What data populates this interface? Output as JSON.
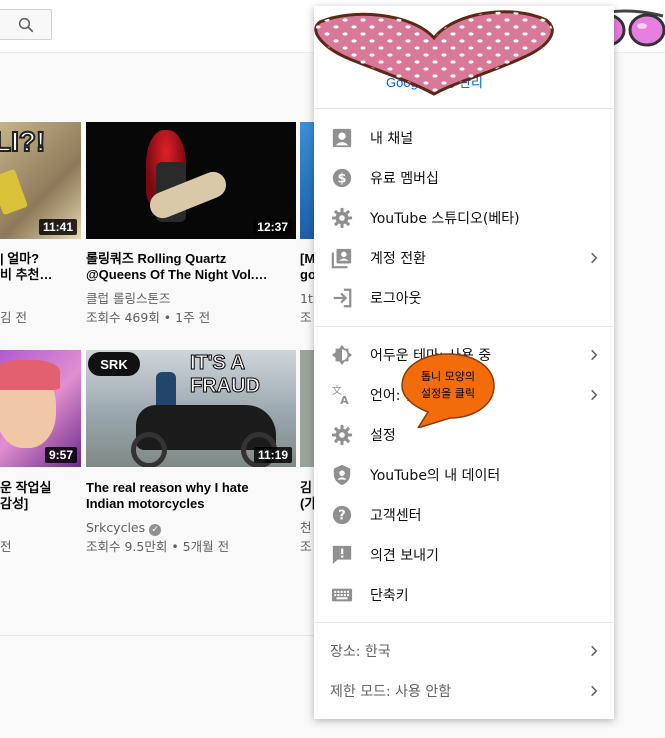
{
  "search": {
    "icon": "search-icon"
  },
  "videos": [
    {
      "id": "v1",
      "title1": "LI?!",
      "duration": "11:41",
      "line1": "| 얼마?",
      "line2": "비 추천…",
      "channel": "",
      "meta": "김 전"
    },
    {
      "id": "v2",
      "title1": "",
      "duration": "12:37",
      "line1": "롤링쿼즈 Rolling Quartz",
      "line2": "@Queens Of The Night Vol.…",
      "channel": "클럽 롤링스톤즈",
      "meta": "조회수 469회 • 1주 전"
    },
    {
      "id": "v3",
      "title1": "",
      "duration": "",
      "line1": "[M",
      "line2": "go",
      "channel": "1th",
      "meta": "조"
    },
    {
      "id": "v4",
      "title1": "",
      "duration": "9:57",
      "line1": "운 작업실",
      "line2": "감성]",
      "channel": "",
      "meta": "전"
    },
    {
      "id": "v5",
      "title1": "IT'S A FRAUD",
      "duration": "11:19",
      "line1": "The real reason why I hate",
      "line2": "Indian motorcycles",
      "channel": "Srkcycles",
      "meta": "조회수 9.5만회 • 5개월 전",
      "badge": "SRK"
    },
    {
      "id": "v6",
      "title1": "",
      "duration": "",
      "line1": "김",
      "line2": "(가",
      "channel": "천",
      "meta": "조"
    }
  ],
  "menu": {
    "manage_account": "Google 계정 관리",
    "items": [
      {
        "label": "내 채널",
        "icon": "person-icon",
        "chevron": false
      },
      {
        "label": "유료 멤버십",
        "icon": "dollar-icon",
        "chevron": false
      },
      {
        "label": "YouTube 스튜디오(베타)",
        "icon": "gear-icon",
        "chevron": false
      },
      {
        "label": "계정 전환",
        "icon": "switch-account-icon",
        "chevron": true
      },
      {
        "label": "로그아웃",
        "icon": "logout-icon",
        "chevron": false
      },
      {
        "label": "어두운 테마: 사용 중",
        "icon": "dark-theme-icon",
        "chevron": true
      },
      {
        "label": "언어: 한국어",
        "icon": "translate-icon",
        "chevron": true
      },
      {
        "label": "설정",
        "icon": "settings-icon",
        "chevron": false
      },
      {
        "label": "YouTube의 내 데이터",
        "icon": "shield-person-icon",
        "chevron": false
      },
      {
        "label": "고객센터",
        "icon": "help-icon",
        "chevron": false
      },
      {
        "label": "의견 보내기",
        "icon": "feedback-icon",
        "chevron": false
      },
      {
        "label": "단축키",
        "icon": "keyboard-icon",
        "chevron": false
      }
    ],
    "location": "장소: 한국",
    "restricted": "제한 모드: 사용 안함"
  },
  "annotation": {
    "line1": "톱니 모양의",
    "line2": "설정을 클릭",
    "color": "#f26d0a"
  },
  "colors": {
    "link": "#065fd4",
    "heart": "#d9799a"
  }
}
